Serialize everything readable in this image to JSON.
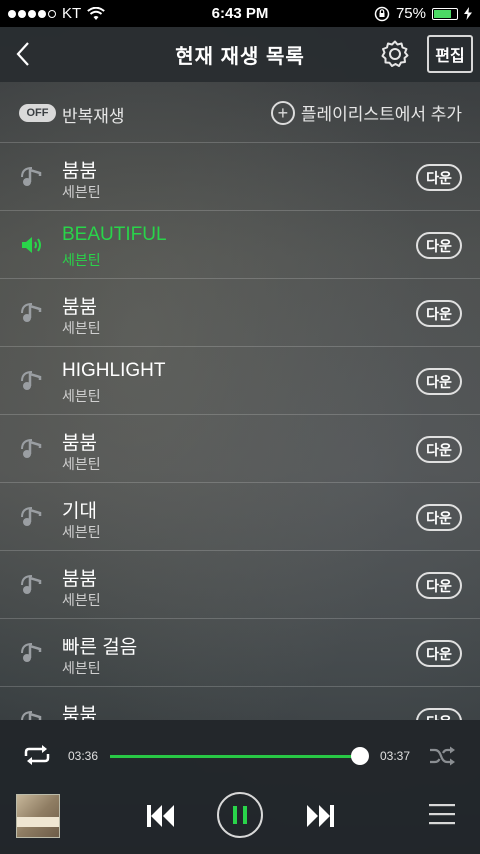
{
  "status_bar": {
    "carrier": "KT",
    "time": "6:43 PM",
    "battery": "75%"
  },
  "header": {
    "title": "현재 재생 목록",
    "edit_label": "편집"
  },
  "options": {
    "repeat_badge": "OFF",
    "repeat_label": "반복재생",
    "add_label": "플레이리스트에서 추가"
  },
  "songs": [
    {
      "title": "붐붐",
      "artist": "세븐틴",
      "action": "다운",
      "playing": false
    },
    {
      "title": "BEAUTIFUL",
      "artist": "세븐틴",
      "action": "다운",
      "playing": true
    },
    {
      "title": "붐붐",
      "artist": "세븐틴",
      "action": "다운",
      "playing": false
    },
    {
      "title": "HIGHLIGHT",
      "artist": "세븐틴",
      "action": "다운",
      "playing": false
    },
    {
      "title": "붐붐",
      "artist": "세븐틴",
      "action": "다운",
      "playing": false
    },
    {
      "title": "기대",
      "artist": "세븐틴",
      "action": "다운",
      "playing": false
    },
    {
      "title": "붐붐",
      "artist": "세븐틴",
      "action": "다운",
      "playing": false
    },
    {
      "title": "빠른 걸음",
      "artist": "세븐틴",
      "action": "다운",
      "playing": false
    },
    {
      "title": "붐붐",
      "artist": "",
      "action": "다운",
      "playing": false
    }
  ],
  "player": {
    "current_time": "03:36",
    "total_time": "03:37",
    "progress": 0.98
  },
  "colors": {
    "accent": "#29d44a",
    "battery": "#4cd964"
  },
  "icons": {
    "back": "back-chevron-icon",
    "settings": "gear-icon",
    "song": "music-note-icon",
    "now_playing": "speaker-icon",
    "repeat": "repeat-icon",
    "shuffle": "shuffle-icon",
    "prev": "skip-previous-icon",
    "pause": "pause-icon",
    "next": "skip-next-icon",
    "menu": "menu-icon"
  }
}
